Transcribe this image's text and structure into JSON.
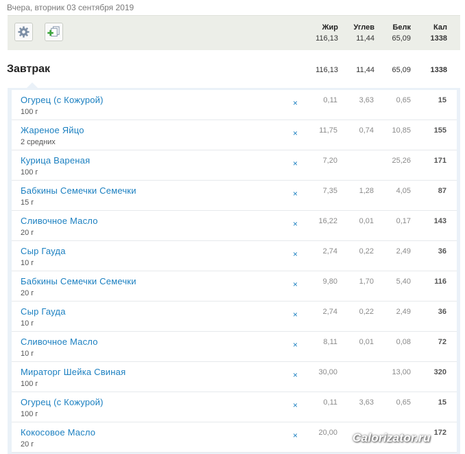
{
  "date_label": "Вчера, вторник 03 сентября 2019",
  "columns": {
    "fat": "Жир",
    "carb": "Углев",
    "prot": "Белк",
    "cal": "Кал"
  },
  "totals": {
    "fat": "116,13",
    "carb": "11,44",
    "prot": "65,09",
    "cal": "1338"
  },
  "meal": {
    "title": "Завтрак",
    "totals": {
      "fat": "116,13",
      "carb": "11,44",
      "prot": "65,09",
      "cal": "1338"
    }
  },
  "remove_glyph": "×",
  "items": [
    {
      "name": "Огурец (с Кожурой)",
      "amount": "100 г",
      "fat": "0,11",
      "carb": "3,63",
      "prot": "0,65",
      "cal": "15"
    },
    {
      "name": "Жареное Яйцо",
      "amount": "2 средних",
      "fat": "11,75",
      "carb": "0,74",
      "prot": "10,85",
      "cal": "155"
    },
    {
      "name": "Курица Вареная",
      "amount": "100 г",
      "fat": "7,20",
      "carb": "",
      "prot": "25,26",
      "cal": "171"
    },
    {
      "name": "Бабкины Семечки Семечки",
      "amount": "15 г",
      "fat": "7,35",
      "carb": "1,28",
      "prot": "4,05",
      "cal": "87"
    },
    {
      "name": "Сливочное Масло",
      "amount": "20 г",
      "fat": "16,22",
      "carb": "0,01",
      "prot": "0,17",
      "cal": "143"
    },
    {
      "name": "Сыр Гауда",
      "amount": "10 г",
      "fat": "2,74",
      "carb": "0,22",
      "prot": "2,49",
      "cal": "36"
    },
    {
      "name": "Бабкины Семечки Семечки",
      "amount": "20 г",
      "fat": "9,80",
      "carb": "1,70",
      "prot": "5,40",
      "cal": "116"
    },
    {
      "name": "Сыр Гауда",
      "amount": "10 г",
      "fat": "2,74",
      "carb": "0,22",
      "prot": "2,49",
      "cal": "36"
    },
    {
      "name": "Сливочное Масло",
      "amount": "10 г",
      "fat": "8,11",
      "carb": "0,01",
      "prot": "0,08",
      "cal": "72"
    },
    {
      "name": "Мираторг Шейка Свиная",
      "amount": "100 г",
      "fat": "30,00",
      "carb": "",
      "prot": "13,00",
      "cal": "320"
    },
    {
      "name": "Огурец (с Кожурой)",
      "amount": "100 г",
      "fat": "0,11",
      "carb": "3,63",
      "prot": "0,65",
      "cal": "15"
    },
    {
      "name": "Кокосовое Масло",
      "amount": "20 г",
      "fat": "20,00",
      "carb": "",
      "prot": "",
      "cal": "172"
    }
  ],
  "watermark": "Calorizator.ru",
  "icons": {
    "settings": "gear-icon",
    "add": "add-item-icon"
  }
}
